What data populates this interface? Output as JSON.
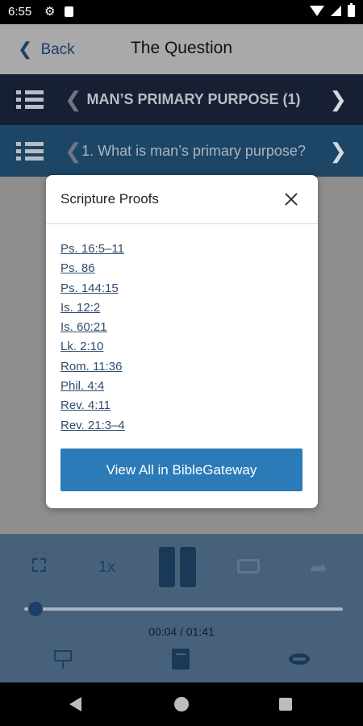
{
  "status_bar": {
    "time": "6:55",
    "icons": [
      "gear-icon",
      "sd-card-icon",
      "wifi-icon",
      "cell-signal-icon",
      "battery-icon"
    ]
  },
  "header": {
    "back_label": "Back",
    "title": "The Question"
  },
  "section_nav": {
    "title": "MAN’S PRIMARY PURPOSE (1)"
  },
  "question_nav": {
    "title": "1. What is man’s primary purpose?"
  },
  "modal": {
    "title": "Scripture Proofs",
    "proofs": [
      "Ps. 16:5–11",
      "Ps. 86",
      "Ps. 144:15",
      "Is. 12:2",
      "Is. 60:21",
      "Lk. 2:10",
      "Rom. 11:36",
      "Phil. 4:4",
      "Rev. 4:11",
      "Rev. 21:3–4"
    ],
    "button_label": "View All in BibleGateway"
  },
  "player": {
    "speed": "1x",
    "time": "00:04 / 01:41",
    "progress": 0.04
  },
  "colors": {
    "accent": "#2b7bb8",
    "nav_dark": "#171f33",
    "nav_mid": "#1d4565"
  }
}
